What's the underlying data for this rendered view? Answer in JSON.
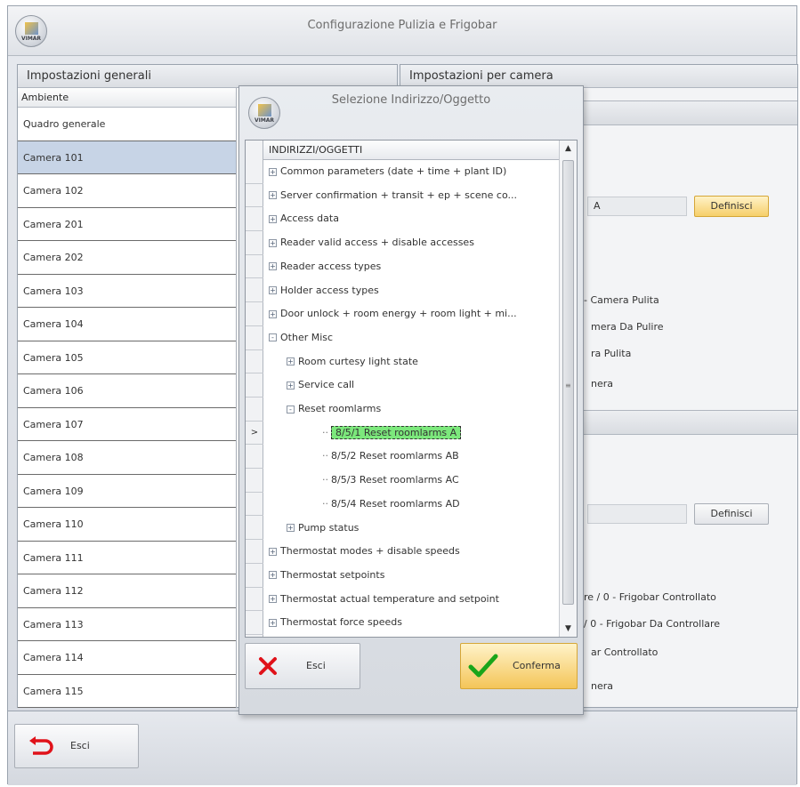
{
  "window": {
    "title": "Configurazione Pulizia e Frigobar",
    "logo_text": "VIMAR"
  },
  "left_panel": {
    "header": "Impostazioni generali",
    "column_header": "Ambiente",
    "rooms": [
      "Quadro generale",
      "Camera 101",
      "Camera 102",
      "Camera 201",
      "Camera 202",
      "Camera 103",
      "Camera 104",
      "Camera 105",
      "Camera 106",
      "Camera 107",
      "Camera 108",
      "Camera 109",
      "Camera 110",
      "Camera 111",
      "Camera 112",
      "Camera 113",
      "Camera 114",
      "Camera 115"
    ],
    "selected_index": 1
  },
  "right_panel": {
    "header": "Impostazioni per camera",
    "field1_value": "A",
    "define_label": "Definisci",
    "texts1": [
      "- Camera Pulita",
      "mera Da Pulire",
      "ra Pulita",
      "nera"
    ],
    "texts2": [
      "re / 0 - Frigobar Controllato",
      "/ 0 - Frigobar Da Controllare",
      "ar Controllato",
      "nera"
    ]
  },
  "bottom": {
    "exit_label": "Esci"
  },
  "dialog": {
    "title": "Selezione Indirizzo/Oggetto",
    "logo_text": "VIMAR",
    "tree_header": "INDIRIZZI/OGGETTI",
    "gutter_marker": ">",
    "tree": [
      {
        "label": "Common parameters (date + time + plant ID)",
        "level": 0,
        "exp": "+"
      },
      {
        "label": "Server confirmation + transit + ep + scene co...",
        "level": 0,
        "exp": "+"
      },
      {
        "label": "Access data",
        "level": 0,
        "exp": "+"
      },
      {
        "label": "Reader valid access + disable accesses",
        "level": 0,
        "exp": "+"
      },
      {
        "label": "Reader access types",
        "level": 0,
        "exp": "+"
      },
      {
        "label": "Holder access types",
        "level": 0,
        "exp": "+"
      },
      {
        "label": "Door unlock + room energy + room light + mi...",
        "level": 0,
        "exp": "+"
      },
      {
        "label": "Other Misc",
        "level": 0,
        "exp": "-"
      },
      {
        "label": "Room curtesy light state",
        "level": 1,
        "exp": "+"
      },
      {
        "label": "Service call",
        "level": 1,
        "exp": "+"
      },
      {
        "label": "Reset roomlarms",
        "level": 1,
        "exp": "-"
      },
      {
        "label": "8/5/1 Reset roomlarms A",
        "level": 2,
        "exp": "",
        "selected": true
      },
      {
        "label": "8/5/2 Reset roomlarms AB",
        "level": 2,
        "exp": ""
      },
      {
        "label": "8/5/3 Reset roomlarms AC",
        "level": 2,
        "exp": ""
      },
      {
        "label": "8/5/4 Reset roomlarms AD",
        "level": 2,
        "exp": ""
      },
      {
        "label": "Pump status",
        "level": 1,
        "exp": "+"
      },
      {
        "label": "Thermostat modes + disable speeds",
        "level": 0,
        "exp": "+"
      },
      {
        "label": "Thermostat setpoints",
        "level": 0,
        "exp": "+"
      },
      {
        "label": "Thermostat actual temperature and setpoint",
        "level": 0,
        "exp": "+"
      },
      {
        "label": "Thermostat force speeds",
        "level": 0,
        "exp": "+"
      }
    ],
    "cancel_label": "Esci",
    "confirm_label": "Conferma"
  },
  "colors": {
    "selection_green": "#7ce87c",
    "selected_row": "#c7d4e6",
    "confirm_button": "#f4c558",
    "exit_icon": "#e0121a"
  }
}
